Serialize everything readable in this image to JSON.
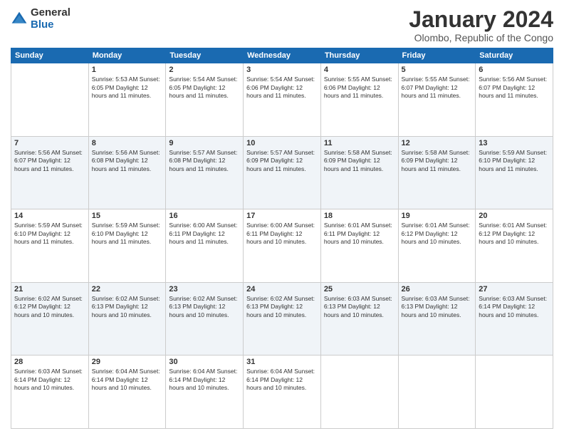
{
  "logo": {
    "general": "General",
    "blue": "Blue"
  },
  "header": {
    "title": "January 2024",
    "subtitle": "Olombo, Republic of the Congo"
  },
  "weekdays": [
    "Sunday",
    "Monday",
    "Tuesday",
    "Wednesday",
    "Thursday",
    "Friday",
    "Saturday"
  ],
  "weeks": [
    [
      {
        "day": "",
        "info": ""
      },
      {
        "day": "1",
        "info": "Sunrise: 5:53 AM\nSunset: 6:05 PM\nDaylight: 12 hours\nand 11 minutes."
      },
      {
        "day": "2",
        "info": "Sunrise: 5:54 AM\nSunset: 6:05 PM\nDaylight: 12 hours\nand 11 minutes."
      },
      {
        "day": "3",
        "info": "Sunrise: 5:54 AM\nSunset: 6:06 PM\nDaylight: 12 hours\nand 11 minutes."
      },
      {
        "day": "4",
        "info": "Sunrise: 5:55 AM\nSunset: 6:06 PM\nDaylight: 12 hours\nand 11 minutes."
      },
      {
        "day": "5",
        "info": "Sunrise: 5:55 AM\nSunset: 6:07 PM\nDaylight: 12 hours\nand 11 minutes."
      },
      {
        "day": "6",
        "info": "Sunrise: 5:56 AM\nSunset: 6:07 PM\nDaylight: 12 hours\nand 11 minutes."
      }
    ],
    [
      {
        "day": "7",
        "info": "Sunrise: 5:56 AM\nSunset: 6:07 PM\nDaylight: 12 hours\nand 11 minutes."
      },
      {
        "day": "8",
        "info": "Sunrise: 5:56 AM\nSunset: 6:08 PM\nDaylight: 12 hours\nand 11 minutes."
      },
      {
        "day": "9",
        "info": "Sunrise: 5:57 AM\nSunset: 6:08 PM\nDaylight: 12 hours\nand 11 minutes."
      },
      {
        "day": "10",
        "info": "Sunrise: 5:57 AM\nSunset: 6:09 PM\nDaylight: 12 hours\nand 11 minutes."
      },
      {
        "day": "11",
        "info": "Sunrise: 5:58 AM\nSunset: 6:09 PM\nDaylight: 12 hours\nand 11 minutes."
      },
      {
        "day": "12",
        "info": "Sunrise: 5:58 AM\nSunset: 6:09 PM\nDaylight: 12 hours\nand 11 minutes."
      },
      {
        "day": "13",
        "info": "Sunrise: 5:59 AM\nSunset: 6:10 PM\nDaylight: 12 hours\nand 11 minutes."
      }
    ],
    [
      {
        "day": "14",
        "info": "Sunrise: 5:59 AM\nSunset: 6:10 PM\nDaylight: 12 hours\nand 11 minutes."
      },
      {
        "day": "15",
        "info": "Sunrise: 5:59 AM\nSunset: 6:10 PM\nDaylight: 12 hours\nand 11 minutes."
      },
      {
        "day": "16",
        "info": "Sunrise: 6:00 AM\nSunset: 6:11 PM\nDaylight: 12 hours\nand 11 minutes."
      },
      {
        "day": "17",
        "info": "Sunrise: 6:00 AM\nSunset: 6:11 PM\nDaylight: 12 hours\nand 10 minutes."
      },
      {
        "day": "18",
        "info": "Sunrise: 6:01 AM\nSunset: 6:11 PM\nDaylight: 12 hours\nand 10 minutes."
      },
      {
        "day": "19",
        "info": "Sunrise: 6:01 AM\nSunset: 6:12 PM\nDaylight: 12 hours\nand 10 minutes."
      },
      {
        "day": "20",
        "info": "Sunrise: 6:01 AM\nSunset: 6:12 PM\nDaylight: 12 hours\nand 10 minutes."
      }
    ],
    [
      {
        "day": "21",
        "info": "Sunrise: 6:02 AM\nSunset: 6:12 PM\nDaylight: 12 hours\nand 10 minutes."
      },
      {
        "day": "22",
        "info": "Sunrise: 6:02 AM\nSunset: 6:13 PM\nDaylight: 12 hours\nand 10 minutes."
      },
      {
        "day": "23",
        "info": "Sunrise: 6:02 AM\nSunset: 6:13 PM\nDaylight: 12 hours\nand 10 minutes."
      },
      {
        "day": "24",
        "info": "Sunrise: 6:02 AM\nSunset: 6:13 PM\nDaylight: 12 hours\nand 10 minutes."
      },
      {
        "day": "25",
        "info": "Sunrise: 6:03 AM\nSunset: 6:13 PM\nDaylight: 12 hours\nand 10 minutes."
      },
      {
        "day": "26",
        "info": "Sunrise: 6:03 AM\nSunset: 6:13 PM\nDaylight: 12 hours\nand 10 minutes."
      },
      {
        "day": "27",
        "info": "Sunrise: 6:03 AM\nSunset: 6:14 PM\nDaylight: 12 hours\nand 10 minutes."
      }
    ],
    [
      {
        "day": "28",
        "info": "Sunrise: 6:03 AM\nSunset: 6:14 PM\nDaylight: 12 hours\nand 10 minutes."
      },
      {
        "day": "29",
        "info": "Sunrise: 6:04 AM\nSunset: 6:14 PM\nDaylight: 12 hours\nand 10 minutes."
      },
      {
        "day": "30",
        "info": "Sunrise: 6:04 AM\nSunset: 6:14 PM\nDaylight: 12 hours\nand 10 minutes."
      },
      {
        "day": "31",
        "info": "Sunrise: 6:04 AM\nSunset: 6:14 PM\nDaylight: 12 hours\nand 10 minutes."
      },
      {
        "day": "",
        "info": ""
      },
      {
        "day": "",
        "info": ""
      },
      {
        "day": "",
        "info": ""
      }
    ]
  ]
}
